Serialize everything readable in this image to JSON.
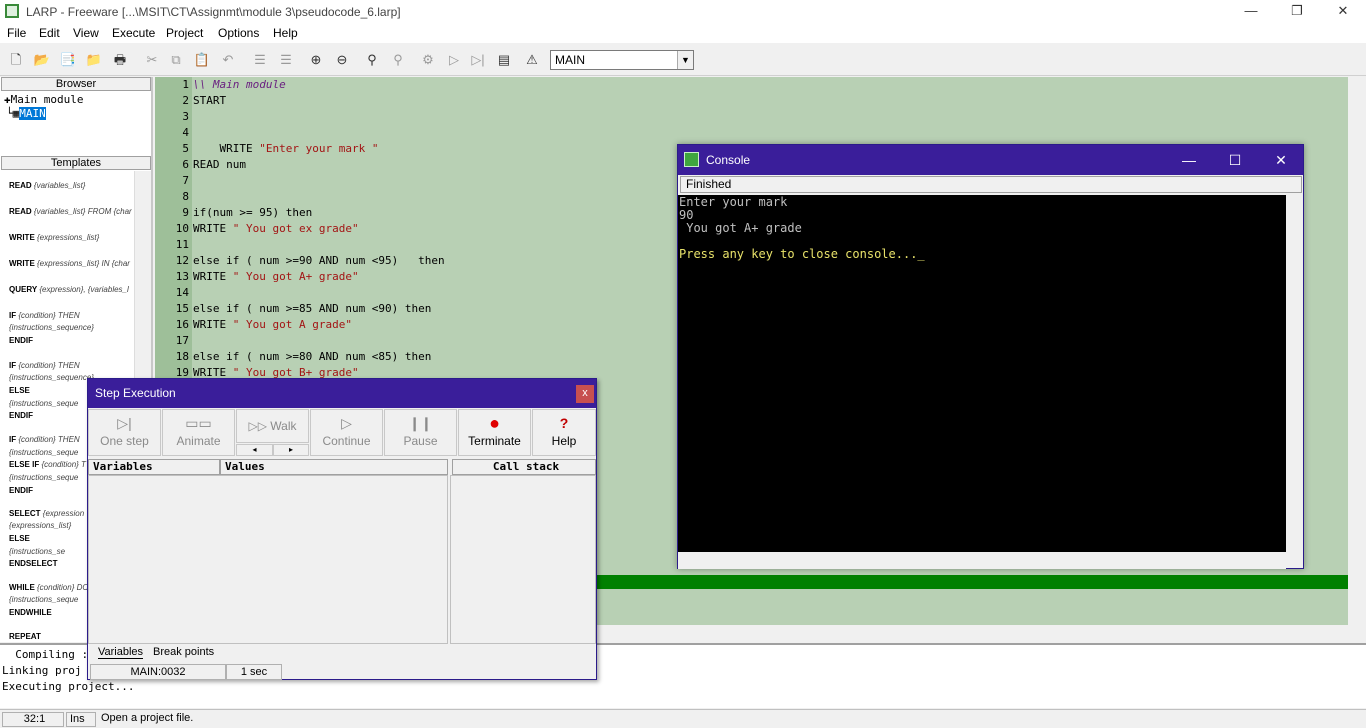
{
  "app": {
    "title": "LARP - Freeware [...\\MSIT\\CT\\Assignmt\\module 3\\pseudocode_6.larp]"
  },
  "menu": [
    "File",
    "Edit",
    "View",
    "Execute",
    "Project",
    "Options",
    "Help"
  ],
  "toolbar": {
    "module_select": "MAIN",
    "icons": [
      "new-icon",
      "open-icon",
      "open-example-icon",
      "folder-icon",
      "print-icon",
      "cut-icon",
      "copy-icon",
      "paste-icon",
      "undo-icon",
      "indent-icon",
      "outdent-icon",
      "zoom-in-icon",
      "zoom-out-icon",
      "find-icon",
      "replace-icon",
      "compile-icon",
      "run-icon",
      "step-run-icon",
      "console-icon",
      "help-icon"
    ]
  },
  "browser": {
    "header": "Browser",
    "root": "Main module",
    "item": "MAIN"
  },
  "templates": {
    "header": "Templates",
    "items": [
      {
        "kw": "READ",
        "rest": " {variables_list}"
      },
      {
        "kw": "READ",
        "rest": " {variables_list} FROM {char"
      },
      {
        "kw": "WRITE",
        "rest": " {expressions_list}"
      },
      {
        "kw": "WRITE",
        "rest": " {expressions_list} IN {char"
      },
      {
        "kw": "QUERY",
        "rest": " {expression}, {variables_l"
      },
      {
        "kw": "IF",
        "rest": " {condition} THEN"
      },
      {
        "kw": "",
        "rest": "   {instructions_sequence}"
      },
      {
        "kw": "ENDIF",
        "rest": ""
      },
      {
        "kw": "IF",
        "rest": " {condition} THEN"
      },
      {
        "kw": "",
        "rest": "   {instructions_sequence}"
      },
      {
        "kw": "ELSE",
        "rest": ""
      },
      {
        "kw": "",
        "rest": "   {instructions_seque"
      },
      {
        "kw": "ENDIF",
        "rest": ""
      },
      {
        "kw": "IF",
        "rest": " {condition} THEN"
      },
      {
        "kw": "",
        "rest": "   {instructions_seque"
      },
      {
        "kw": "ELSE IF",
        "rest": " {condition} T"
      },
      {
        "kw": "",
        "rest": "   {instructions_seque"
      },
      {
        "kw": "ENDIF",
        "rest": ""
      },
      {
        "kw": "SELECT",
        "rest": " {expression"
      },
      {
        "kw": "",
        "rest": "   {expressions_list}"
      },
      {
        "kw": "   ELSE",
        "rest": ""
      },
      {
        "kw": "",
        "rest": "     {instructions_se"
      },
      {
        "kw": "ENDSELECT",
        "rest": ""
      },
      {
        "kw": "WHILE",
        "rest": " {condition} DO"
      },
      {
        "kw": "",
        "rest": "   {instructions_seque"
      },
      {
        "kw": "ENDWHILE",
        "rest": ""
      },
      {
        "kw": "REPEAT",
        "rest": ""
      }
    ]
  },
  "code_lines": [
    {
      "n": "1",
      "parts": [
        {
          "t": "\\\\ Main module",
          "c": "cmt"
        }
      ]
    },
    {
      "n": "2",
      "parts": [
        {
          "t": "START",
          "c": ""
        }
      ]
    },
    {
      "n": "3",
      "parts": []
    },
    {
      "n": "4",
      "parts": []
    },
    {
      "n": "5",
      "parts": [
        {
          "t": "    WRITE ",
          "c": ""
        },
        {
          "t": "\"Enter your mark \"",
          "c": "str"
        }
      ]
    },
    {
      "n": "6",
      "parts": [
        {
          "t": "READ num",
          "c": ""
        }
      ]
    },
    {
      "n": "7",
      "parts": []
    },
    {
      "n": "8",
      "parts": []
    },
    {
      "n": "9",
      "parts": [
        {
          "t": "if(num >= 95) then",
          "c": ""
        }
      ]
    },
    {
      "n": "10",
      "parts": [
        {
          "t": "WRITE ",
          "c": ""
        },
        {
          "t": "\" You got ex grade\"",
          "c": "str"
        }
      ]
    },
    {
      "n": "11",
      "parts": []
    },
    {
      "n": "12",
      "parts": [
        {
          "t": "else if ( num >=90 AND num <95)   then",
          "c": ""
        }
      ]
    },
    {
      "n": "13",
      "parts": [
        {
          "t": "WRITE ",
          "c": ""
        },
        {
          "t": "\" You got A+ grade\"",
          "c": "str"
        }
      ]
    },
    {
      "n": "14",
      "parts": []
    },
    {
      "n": "15",
      "parts": [
        {
          "t": "else if ( num >=85 AND num <90) then",
          "c": ""
        }
      ]
    },
    {
      "n": "16",
      "parts": [
        {
          "t": "WRITE ",
          "c": ""
        },
        {
          "t": "\" You got A grade\"",
          "c": "str"
        }
      ]
    },
    {
      "n": "17",
      "parts": []
    },
    {
      "n": "18",
      "parts": [
        {
          "t": "else if ( num >=80 AND num <85) then",
          "c": ""
        }
      ]
    },
    {
      "n": "19",
      "parts": [
        {
          "t": "WRITE ",
          "c": ""
        },
        {
          "t": "\" You got B+ grade\"",
          "c": "str"
        }
      ]
    }
  ],
  "output": {
    "lines": [
      "  Compiling :",
      "Linking proj",
      "Executing project..."
    ]
  },
  "status": {
    "position": "32:1",
    "mode": "Ins",
    "message": "Open a project file."
  },
  "step_execution": {
    "title": "Step Execution",
    "close": "x",
    "buttons": [
      {
        "label": "One step",
        "icon": "▷|",
        "name": "one-step-button",
        "icon_name": "step-icon",
        "active": false
      },
      {
        "label": "Animate",
        "icon": "▭▭",
        "name": "animate-button",
        "icon_name": "film-icon",
        "active": false
      },
      {
        "label": "Walk",
        "icon": "▷▷",
        "name": "walk-button",
        "icon_name": "fast-forward-icon",
        "active": false
      },
      {
        "label": "Continue",
        "icon": "▷",
        "name": "continue-button",
        "icon_name": "play-icon",
        "active": false
      },
      {
        "label": "Pause",
        "icon": "❙❙",
        "name": "pause-button",
        "icon_name": "pause-icon",
        "active": false
      },
      {
        "label": "Terminate",
        "icon": "●",
        "name": "terminate-button",
        "icon_name": "stop-icon",
        "active": true
      },
      {
        "label": "Help",
        "icon": "?",
        "name": "help-button",
        "icon_name": "help-icon",
        "active": true
      }
    ],
    "walk_slower": "◂",
    "walk_faster": "▸",
    "columns": {
      "variables": "Variables",
      "values": "Values",
      "call_stack": "Call stack"
    },
    "tabs": [
      "Variables",
      "Break points"
    ],
    "location": "MAIN:0032",
    "delay": "1 sec"
  },
  "console": {
    "title": "Console",
    "status": "Finished",
    "lines": [
      "Enter your mark",
      "90",
      " You got A+ grade"
    ],
    "prompt": "Press any key to close console...",
    "colors": {
      "text": "#c0c0c0",
      "prompt": "#e8e26a",
      "background": "#000000"
    }
  }
}
